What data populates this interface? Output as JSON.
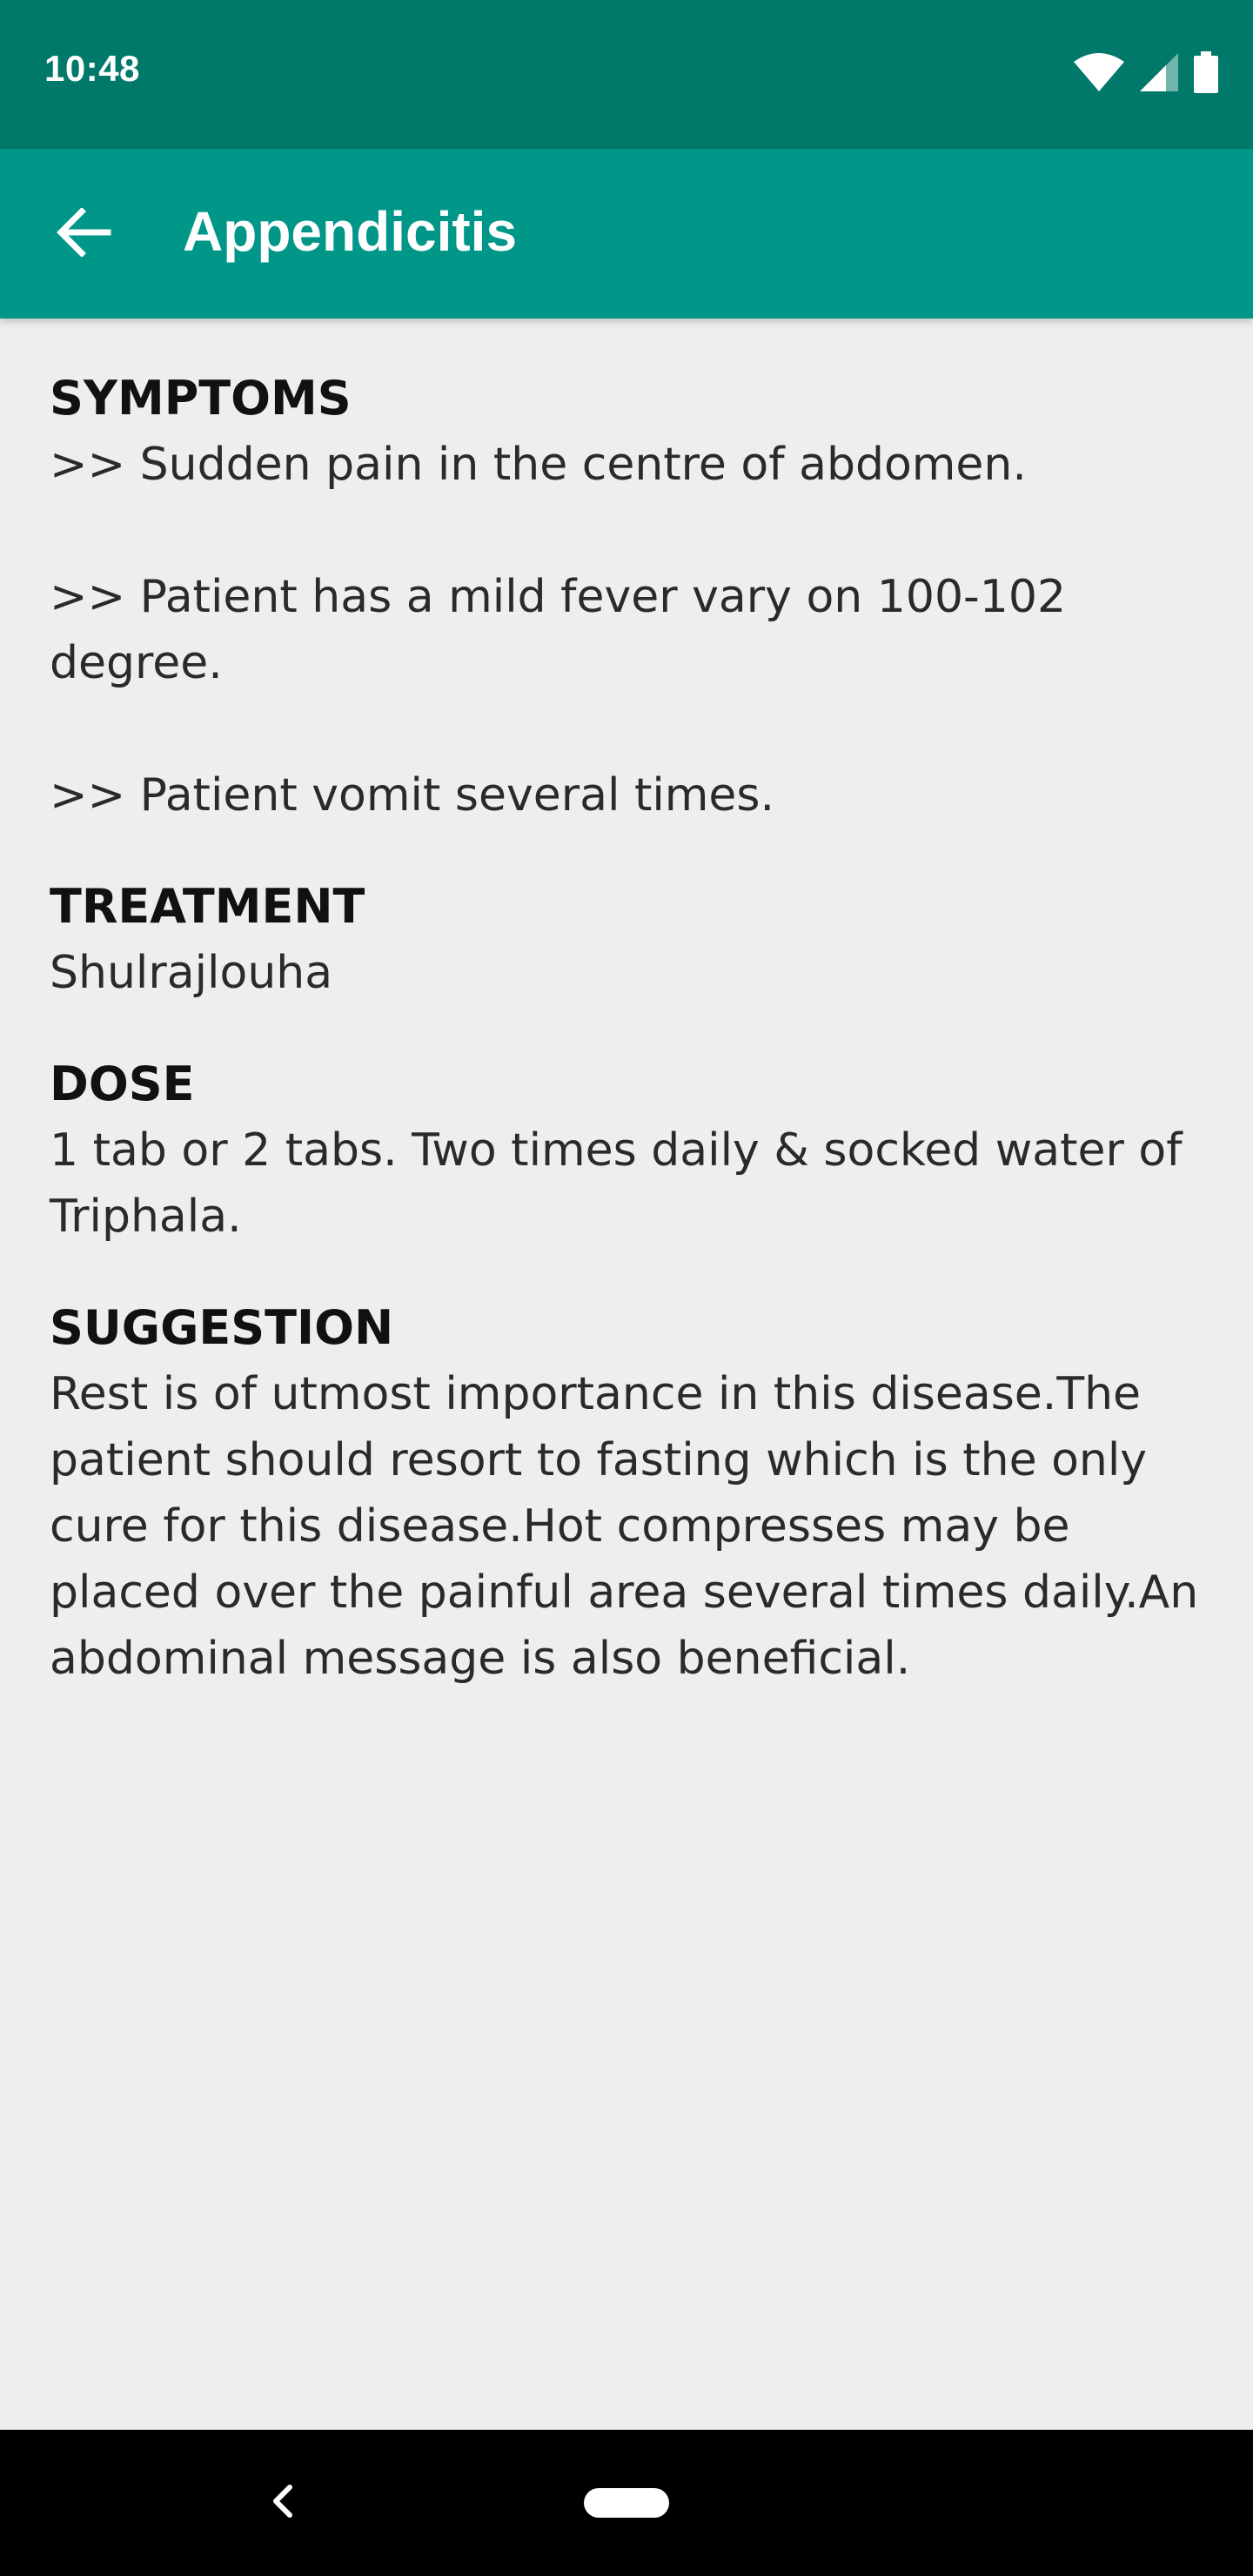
{
  "status_bar": {
    "time": "10:48",
    "icons": [
      "wifi-icon",
      "cell-signal-icon",
      "battery-icon"
    ]
  },
  "app_bar": {
    "title": "Appendicitis",
    "back_icon": "arrow-left-icon"
  },
  "sections": [
    {
      "heading": "SYMPTOMS",
      "body": ">> Sudden pain in the centre of abdomen.\n\n>> Patient has a mild fever vary on 100-102 degree.\n\n>> Patient vomit several times."
    },
    {
      "heading": "TREATMENT",
      "body": "Shulrajlouha"
    },
    {
      "heading": "DOSE",
      "body": "1 tab or 2 tabs. Two times daily & socked water of Triphala."
    },
    {
      "heading": "SUGGESTION",
      "body": "Rest is of utmost importance in this disease.The patient should resort to fasting which is the only cure for this disease.Hot compresses may be placed over the painful area several times daily.An abdominal message is also beneficial."
    }
  ],
  "nav_bar": {
    "back_icon": "nav-back-icon",
    "home_icon": "nav-home-pill-icon"
  },
  "colors": {
    "status_bar": "#00796b",
    "app_bar": "#009688",
    "background": "#eeeeee",
    "nav_bar": "#000000"
  }
}
